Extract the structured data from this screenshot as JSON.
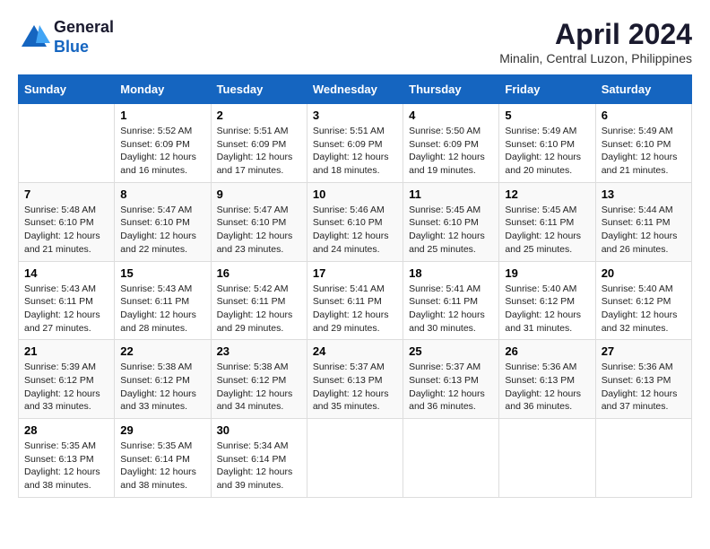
{
  "logo": {
    "line1": "General",
    "line2": "Blue"
  },
  "title": "April 2024",
  "subtitle": "Minalin, Central Luzon, Philippines",
  "days_header": [
    "Sunday",
    "Monday",
    "Tuesday",
    "Wednesday",
    "Thursday",
    "Friday",
    "Saturday"
  ],
  "weeks": [
    [
      {
        "day": "",
        "info": ""
      },
      {
        "day": "1",
        "info": "Sunrise: 5:52 AM\nSunset: 6:09 PM\nDaylight: 12 hours\nand 16 minutes."
      },
      {
        "day": "2",
        "info": "Sunrise: 5:51 AM\nSunset: 6:09 PM\nDaylight: 12 hours\nand 17 minutes."
      },
      {
        "day": "3",
        "info": "Sunrise: 5:51 AM\nSunset: 6:09 PM\nDaylight: 12 hours\nand 18 minutes."
      },
      {
        "day": "4",
        "info": "Sunrise: 5:50 AM\nSunset: 6:09 PM\nDaylight: 12 hours\nand 19 minutes."
      },
      {
        "day": "5",
        "info": "Sunrise: 5:49 AM\nSunset: 6:10 PM\nDaylight: 12 hours\nand 20 minutes."
      },
      {
        "day": "6",
        "info": "Sunrise: 5:49 AM\nSunset: 6:10 PM\nDaylight: 12 hours\nand 21 minutes."
      }
    ],
    [
      {
        "day": "7",
        "info": "Sunrise: 5:48 AM\nSunset: 6:10 PM\nDaylight: 12 hours\nand 21 minutes."
      },
      {
        "day": "8",
        "info": "Sunrise: 5:47 AM\nSunset: 6:10 PM\nDaylight: 12 hours\nand 22 minutes."
      },
      {
        "day": "9",
        "info": "Sunrise: 5:47 AM\nSunset: 6:10 PM\nDaylight: 12 hours\nand 23 minutes."
      },
      {
        "day": "10",
        "info": "Sunrise: 5:46 AM\nSunset: 6:10 PM\nDaylight: 12 hours\nand 24 minutes."
      },
      {
        "day": "11",
        "info": "Sunrise: 5:45 AM\nSunset: 6:10 PM\nDaylight: 12 hours\nand 25 minutes."
      },
      {
        "day": "12",
        "info": "Sunrise: 5:45 AM\nSunset: 6:11 PM\nDaylight: 12 hours\nand 25 minutes."
      },
      {
        "day": "13",
        "info": "Sunrise: 5:44 AM\nSunset: 6:11 PM\nDaylight: 12 hours\nand 26 minutes."
      }
    ],
    [
      {
        "day": "14",
        "info": "Sunrise: 5:43 AM\nSunset: 6:11 PM\nDaylight: 12 hours\nand 27 minutes."
      },
      {
        "day": "15",
        "info": "Sunrise: 5:43 AM\nSunset: 6:11 PM\nDaylight: 12 hours\nand 28 minutes."
      },
      {
        "day": "16",
        "info": "Sunrise: 5:42 AM\nSunset: 6:11 PM\nDaylight: 12 hours\nand 29 minutes."
      },
      {
        "day": "17",
        "info": "Sunrise: 5:41 AM\nSunset: 6:11 PM\nDaylight: 12 hours\nand 29 minutes."
      },
      {
        "day": "18",
        "info": "Sunrise: 5:41 AM\nSunset: 6:11 PM\nDaylight: 12 hours\nand 30 minutes."
      },
      {
        "day": "19",
        "info": "Sunrise: 5:40 AM\nSunset: 6:12 PM\nDaylight: 12 hours\nand 31 minutes."
      },
      {
        "day": "20",
        "info": "Sunrise: 5:40 AM\nSunset: 6:12 PM\nDaylight: 12 hours\nand 32 minutes."
      }
    ],
    [
      {
        "day": "21",
        "info": "Sunrise: 5:39 AM\nSunset: 6:12 PM\nDaylight: 12 hours\nand 33 minutes."
      },
      {
        "day": "22",
        "info": "Sunrise: 5:38 AM\nSunset: 6:12 PM\nDaylight: 12 hours\nand 33 minutes."
      },
      {
        "day": "23",
        "info": "Sunrise: 5:38 AM\nSunset: 6:12 PM\nDaylight: 12 hours\nand 34 minutes."
      },
      {
        "day": "24",
        "info": "Sunrise: 5:37 AM\nSunset: 6:13 PM\nDaylight: 12 hours\nand 35 minutes."
      },
      {
        "day": "25",
        "info": "Sunrise: 5:37 AM\nSunset: 6:13 PM\nDaylight: 12 hours\nand 36 minutes."
      },
      {
        "day": "26",
        "info": "Sunrise: 5:36 AM\nSunset: 6:13 PM\nDaylight: 12 hours\nand 36 minutes."
      },
      {
        "day": "27",
        "info": "Sunrise: 5:36 AM\nSunset: 6:13 PM\nDaylight: 12 hours\nand 37 minutes."
      }
    ],
    [
      {
        "day": "28",
        "info": "Sunrise: 5:35 AM\nSunset: 6:13 PM\nDaylight: 12 hours\nand 38 minutes."
      },
      {
        "day": "29",
        "info": "Sunrise: 5:35 AM\nSunset: 6:14 PM\nDaylight: 12 hours\nand 38 minutes."
      },
      {
        "day": "30",
        "info": "Sunrise: 5:34 AM\nSunset: 6:14 PM\nDaylight: 12 hours\nand 39 minutes."
      },
      {
        "day": "",
        "info": ""
      },
      {
        "day": "",
        "info": ""
      },
      {
        "day": "",
        "info": ""
      },
      {
        "day": "",
        "info": ""
      }
    ]
  ]
}
